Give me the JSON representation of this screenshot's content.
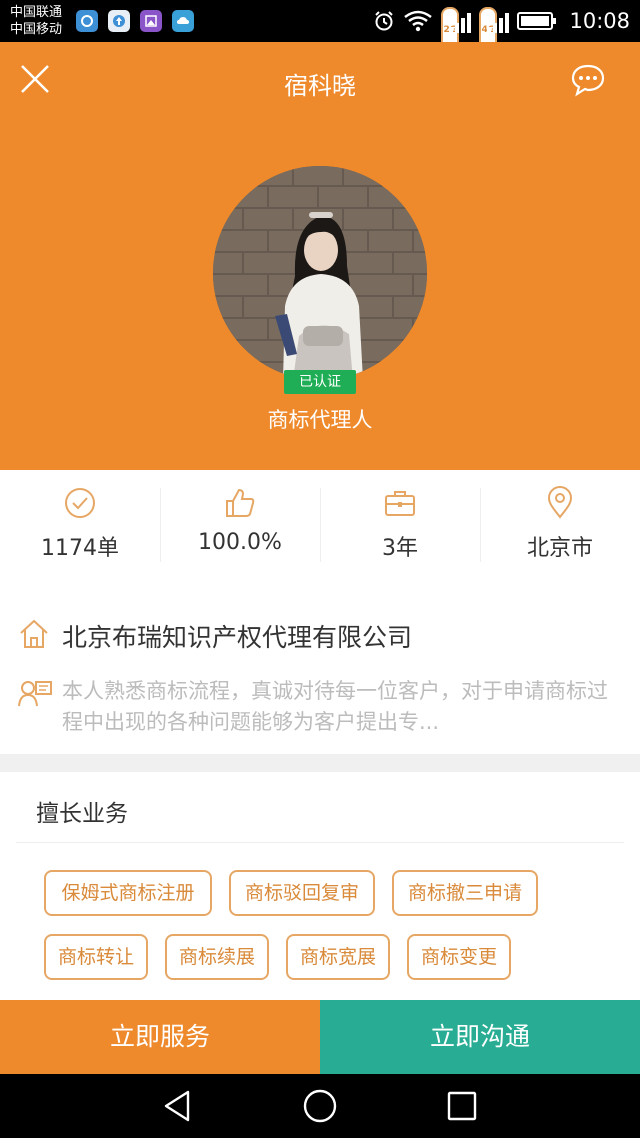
{
  "status_bar": {
    "carrier_1": "中国联通",
    "carrier_2": "中国移动",
    "net_1": "2G",
    "net_2": "4G",
    "time": "10:08"
  },
  "header": {
    "title": "宿科晓",
    "verified_badge": "已认证",
    "role": "商标代理人",
    "bg_color": "#ee8a2c"
  },
  "stats": [
    {
      "icon": "check-circle-icon",
      "value": "1174单"
    },
    {
      "icon": "thumbs-up-icon",
      "value": "100.0%"
    },
    {
      "icon": "briefcase-icon",
      "value": "3年"
    },
    {
      "icon": "location-pin-icon",
      "value": "北京市"
    }
  ],
  "company": {
    "name": "北京布瑞知识产权代理有限公司",
    "bio": "本人熟悉商标流程，真诚对待每一位客户，对于申请商标过程中出现的各种问题能够为客户提出专..."
  },
  "specialties": {
    "title": "擅长业务",
    "tags": [
      "保姆式商标注册",
      "商标驳回复审",
      "商标撤三申请",
      "商标转让",
      "商标续展",
      "商标宽展",
      "商标变更"
    ]
  },
  "actions": {
    "serve_label": "立即服务",
    "chat_label": "立即沟通",
    "serve_color": "#ee8a2c",
    "chat_color": "#28ad94"
  }
}
